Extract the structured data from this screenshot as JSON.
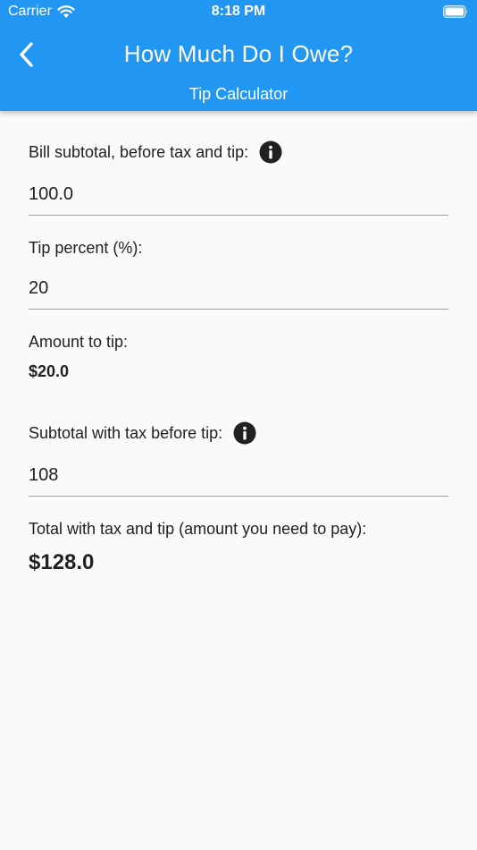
{
  "status_bar": {
    "carrier": "Carrier",
    "time": "8:18 PM"
  },
  "header": {
    "title": "How Much Do I Owe?",
    "subtitle": "Tip Calculator",
    "background_color": "#2196f3"
  },
  "form": {
    "bill_subtotal": {
      "label": "Bill subtotal, before tax and tip:",
      "value": "100.0"
    },
    "tip_percent": {
      "label": "Tip percent (%):",
      "value": "20"
    },
    "amount_to_tip": {
      "label": "Amount to tip:",
      "value": "$20.0"
    },
    "subtotal_with_tax": {
      "label": "Subtotal with tax before tip:",
      "value": "108"
    },
    "total": {
      "label": "Total with tax and tip (amount you need to pay):",
      "value": "$128.0"
    }
  },
  "icons": {
    "back": "chevron-left-icon",
    "info": "info-icon",
    "wifi": "wifi-icon",
    "battery": "battery-icon"
  }
}
